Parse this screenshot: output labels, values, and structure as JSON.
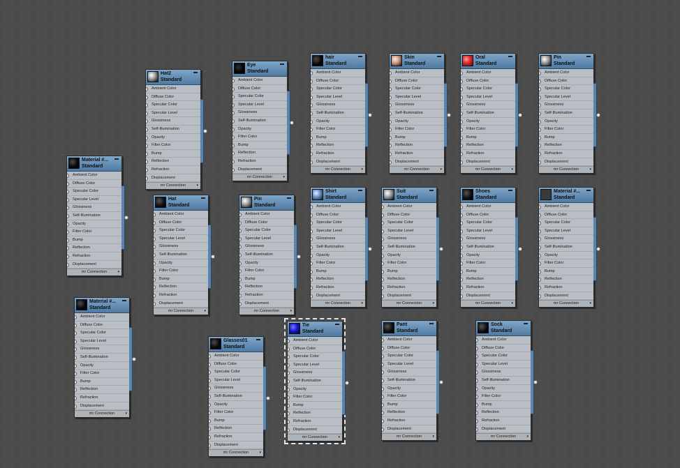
{
  "slot_labels": [
    "Ambient Color",
    "Diffuse Color",
    "Specular Color",
    "Specular Level",
    "Glossiness",
    "Self-Illumination",
    "Opacity",
    "Filter Color",
    "Bump",
    "Reflection",
    "Refraction",
    "Displacement"
  ],
  "footer_label": "mr Connection",
  "nodes": [
    {
      "id": "hat2",
      "name": "Hat2",
      "type": "Standard",
      "swatch": "gray"
    },
    {
      "id": "eye",
      "name": "Eye",
      "type": "Standard",
      "swatch": "eye"
    },
    {
      "id": "hair",
      "name": "hair",
      "type": "Standard",
      "swatch": "dark"
    },
    {
      "id": "skin",
      "name": "Skin",
      "type": "Standard",
      "swatch": "skin"
    },
    {
      "id": "oral",
      "name": "Oral",
      "type": "Standard",
      "swatch": "oral"
    },
    {
      "id": "pin-top",
      "name": "Pin",
      "type": "Standard",
      "swatch": "gray"
    },
    {
      "id": "material-1",
      "name": "Material #...",
      "type": "Standard",
      "swatch": "dark"
    },
    {
      "id": "hat",
      "name": "Hat",
      "type": "Standard",
      "swatch": "black"
    },
    {
      "id": "pin",
      "name": "Pin",
      "type": "Standard",
      "swatch": "gray"
    },
    {
      "id": "shirt",
      "name": "Shirt",
      "type": "Standard",
      "swatch": "shirt"
    },
    {
      "id": "suit",
      "name": "Suit",
      "type": "Standard",
      "swatch": "gray"
    },
    {
      "id": "shoes",
      "name": "Shoes",
      "type": "Standard",
      "swatch": "black"
    },
    {
      "id": "material-2",
      "name": "Material #...",
      "type": "Standard",
      "swatch": "checker"
    },
    {
      "id": "material-3",
      "name": "Material #...",
      "type": "Standard",
      "swatch": "dark"
    },
    {
      "id": "glasses01",
      "name": "Glasses01",
      "type": "Standard",
      "swatch": "dark"
    },
    {
      "id": "tie",
      "name": "Tie",
      "type": "Standard",
      "swatch": "blue",
      "selected": true
    },
    {
      "id": "pant",
      "name": "Pant",
      "type": "Standard",
      "swatch": "black"
    },
    {
      "id": "sock",
      "name": "Sock",
      "type": "Standard",
      "swatch": "black"
    }
  ]
}
